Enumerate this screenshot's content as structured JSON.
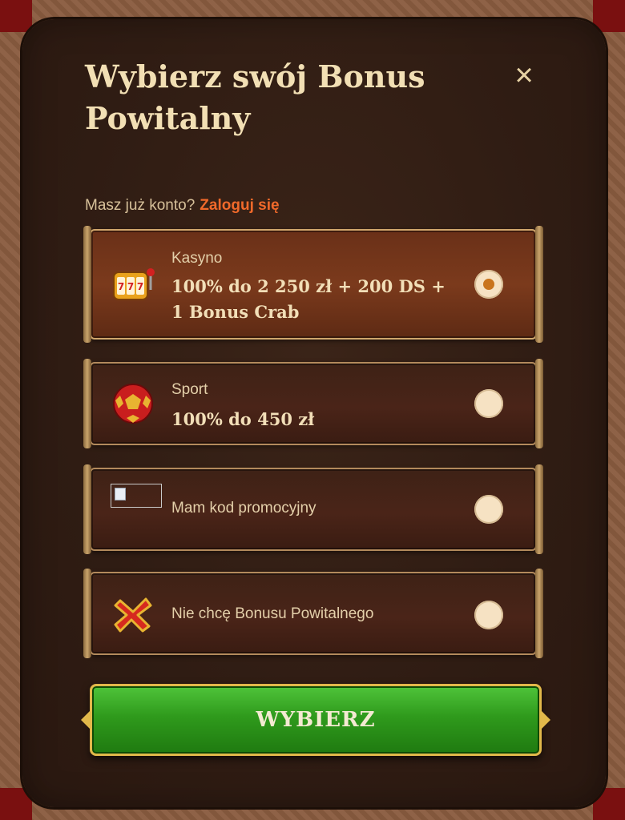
{
  "modal": {
    "title": "Wybierz swój Bonus Powitalny",
    "close_icon": "×",
    "login_prompt": "Masz już konto?",
    "login_link": "Zaloguj się"
  },
  "options": [
    {
      "category": "Kasyno",
      "main": "100% do 2 250 zł + 200 DS + 1 Bonus Crab",
      "icon": "slot-machine-icon",
      "selected": true
    },
    {
      "category": "Sport",
      "main": "100% do 450 zł",
      "icon": "soccer-ball-icon",
      "selected": false
    },
    {
      "label": "Mam kod promocyjny",
      "icon": "broken-image-icon",
      "selected": false
    },
    {
      "label": "Nie chcę Bonusu Powitalnego",
      "icon": "red-x-icon",
      "selected": false
    }
  ],
  "cta": {
    "label": "WYBIERZ"
  },
  "colors": {
    "accent_link": "#f0692a",
    "cta_green": "#2f9a1c",
    "radio_dot": "#c9741c"
  }
}
